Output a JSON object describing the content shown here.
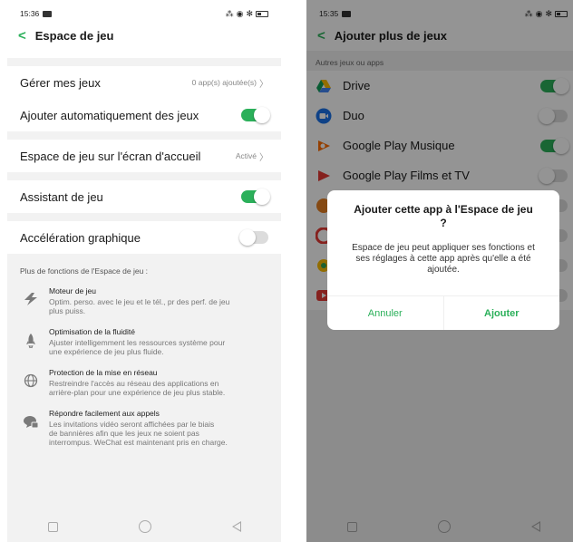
{
  "left": {
    "status": {
      "time": "15:36"
    },
    "title": "Espace de jeu",
    "rows": {
      "manage_label": "Gérer mes jeux",
      "manage_value": "0 app(s) ajoutée(s)",
      "auto_add_label": "Ajouter automatiquement des jeux",
      "auto_add_on": true,
      "home_label": "Espace de jeu sur l'écran d'accueil",
      "home_value": "Activé",
      "assistant_label": "Assistant de jeu",
      "assistant_on": true,
      "accel_label": "Accélération graphique",
      "accel_on": false
    },
    "more_heading": "Plus de fonctions de l'Espace de jeu :",
    "features": [
      {
        "icon": "lightning-icon",
        "title": "Moteur de jeu",
        "desc": [
          "Optim. perso. avec le jeu et le tél., pr des perf. de jeu",
          "plus puiss."
        ]
      },
      {
        "icon": "rocket-icon",
        "title": "Optimisation de la fluidité",
        "desc": [
          "Ajuster intelligemment les ressources système pour",
          "une expérience de jeu plus fluide."
        ]
      },
      {
        "icon": "globe-icon",
        "title": "Protection de la mise en réseau",
        "desc": [
          "Restreindre l'accès au réseau des applications en",
          "arrière-plan pour une expérience de jeu plus stable."
        ]
      },
      {
        "icon": "chat-call-icon",
        "title": "Répondre facilement aux appels",
        "desc": [
          "Les invitations vidéo seront affichées par le biais",
          "de bannières afin que les jeux ne soient pas",
          "interrompus. WeChat est maintenant pris en charge."
        ]
      }
    ]
  },
  "right": {
    "status": {
      "time": "15:35"
    },
    "title": "Ajouter plus de jeux",
    "subheading": "Autres jeux ou apps",
    "apps": [
      {
        "name": "Drive",
        "icon": "drive-icon",
        "on": true
      },
      {
        "name": "Duo",
        "icon": "duo-icon",
        "on": false
      },
      {
        "name": "Google Play Musique",
        "icon": "play-music-icon",
        "on": true
      },
      {
        "name": "Google Play Films et TV",
        "icon": "play-movies-icon",
        "on": false
      }
    ],
    "dialog": {
      "title": "Ajouter cette app à l'Espace de jeu ?",
      "message": "Espace de jeu peut appliquer ses fonctions et ses réglages à cette app après qu'elle a été ajoutée.",
      "cancel": "Annuler",
      "confirm": "Ajouter"
    }
  },
  "colors": {
    "accent": "#2bb05a",
    "toggle_off": "#dcdcdc"
  }
}
